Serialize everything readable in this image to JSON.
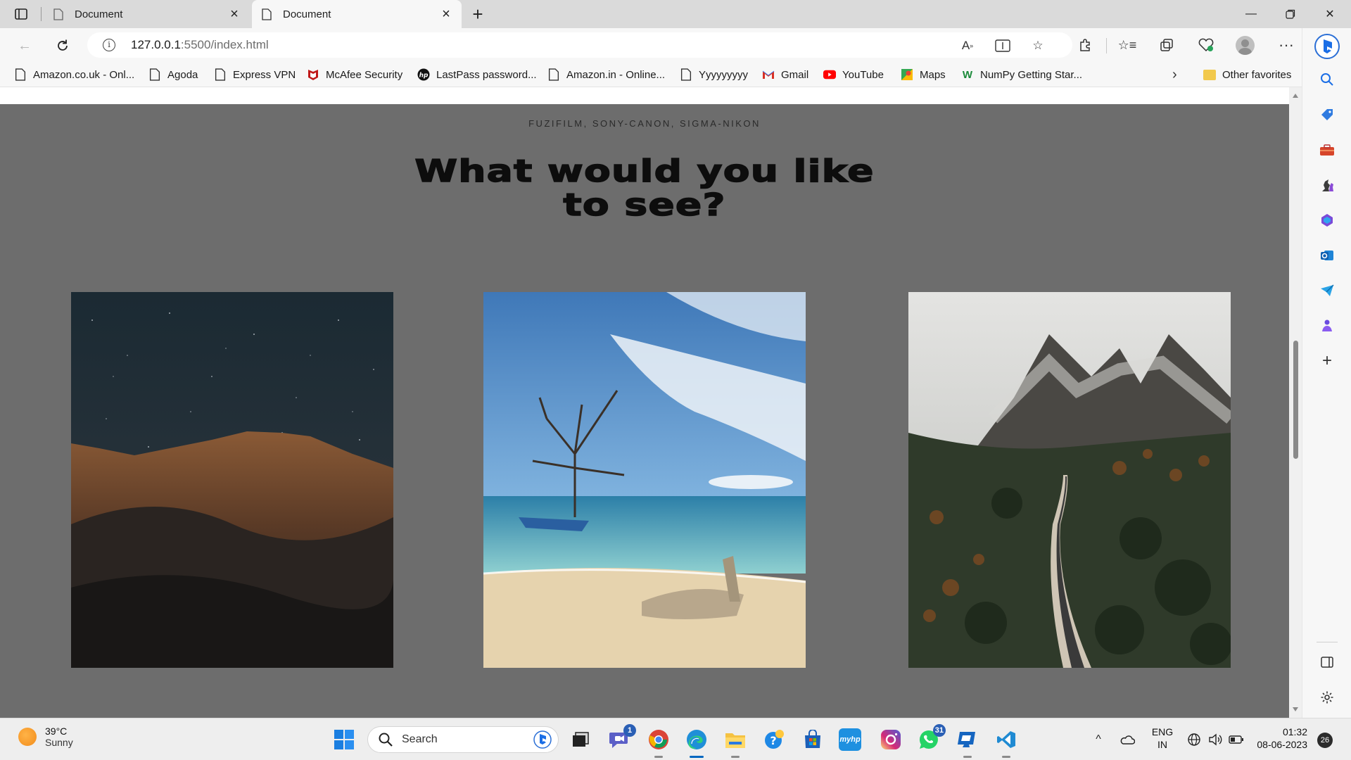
{
  "tabs": [
    {
      "title": "Document"
    },
    {
      "title": "Document"
    }
  ],
  "address": {
    "host": "127.0.0.1",
    "path": ":5500/index.html"
  },
  "favorites": [
    {
      "label": "Amazon.co.uk - Onl...",
      "icon": "page-icon"
    },
    {
      "label": "Agoda",
      "icon": "page-icon"
    },
    {
      "label": "Express VPN",
      "icon": "page-icon"
    },
    {
      "label": "McAfee Security",
      "icon": "mcafee-icon"
    },
    {
      "label": "LastPass password...",
      "icon": "hp-icon"
    },
    {
      "label": "Amazon.in - Online...",
      "icon": "page-icon"
    },
    {
      "label": "Yyyyyyyyy",
      "icon": "page-icon"
    },
    {
      "label": "Gmail",
      "icon": "gmail-icon"
    },
    {
      "label": "YouTube",
      "icon": "youtube-icon"
    },
    {
      "label": "Maps",
      "icon": "maps-icon"
    },
    {
      "label": "NumPy Getting Star...",
      "icon": "w-icon"
    }
  ],
  "other_favorites": "Other favorites",
  "page": {
    "eyebrow": "FUZIFILM, SONY-CANON, SIGMA-NIKON",
    "headline_line1": "What would you like",
    "headline_line2": "to see?",
    "photos": [
      {
        "subject": "starry-mountain-night-photo"
      },
      {
        "subject": "beach-tree-boat-photo"
      },
      {
        "subject": "forest-road-mountains-photo"
      }
    ]
  },
  "taskbar": {
    "weather_temp": "39°C",
    "weather_desc": "Sunny",
    "search_placeholder": "Search",
    "teams_badge": "1",
    "whatsapp_badge": "31",
    "lang_line1": "ENG",
    "lang_line2": "IN",
    "time": "01:32",
    "date": "08-06-2023",
    "notifications": "26"
  },
  "colors": {
    "page_bg": "#6d6d6d",
    "accent": "#0067c0"
  }
}
